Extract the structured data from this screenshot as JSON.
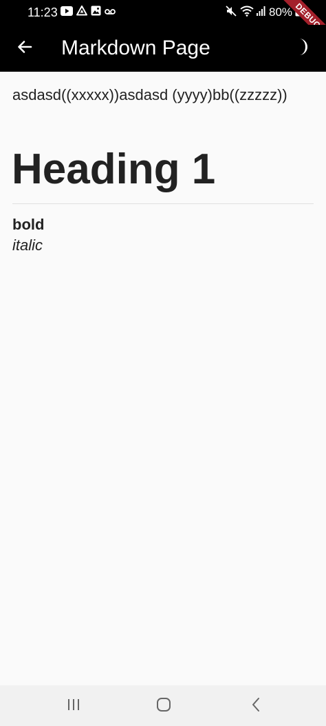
{
  "status_bar": {
    "time": "11:23",
    "battery": "80%",
    "left_icons": [
      "youtube-icon",
      "drive-icon",
      "image-icon",
      "voicemail-icon"
    ],
    "right_icons": [
      "mute-icon",
      "wifi-icon",
      "signal-icon",
      "battery-icon"
    ]
  },
  "debug_banner": "DEBUG",
  "app_bar": {
    "title": "Markdown Page",
    "back_icon": "arrow-back-icon",
    "theme_icon": "moon-icon",
    "background": "#000000",
    "foreground": "#ffffff"
  },
  "content": {
    "paragraph": "asdasd((xxxxx))asdasd (yyyy)bb((zzzzz))",
    "heading_1": "Heading 1",
    "bold": "bold",
    "italic": "italic"
  },
  "nav_bar": {
    "buttons": [
      "recents-icon",
      "home-icon",
      "back-icon"
    ]
  },
  "colors": {
    "page_background": "#fafafa",
    "text": "#222222",
    "debug_banner": "#a3202b"
  }
}
